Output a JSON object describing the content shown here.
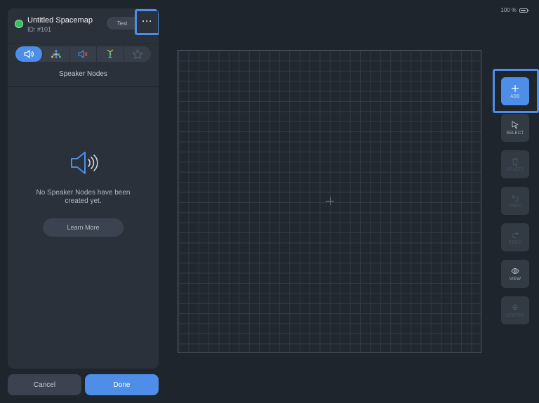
{
  "status_bar": {
    "battery": "100 %"
  },
  "panel": {
    "title": "Untitled Spacemap",
    "subtitle": "ID: #101",
    "test_label": "Test",
    "more_label": "···",
    "tabs": [
      {
        "icon": "speaker-icon",
        "active": true
      },
      {
        "icon": "node-network-icon",
        "active": false
      },
      {
        "icon": "speaker-muted-icon",
        "active": false
      },
      {
        "icon": "antenna-icon",
        "active": false
      },
      {
        "icon": "star-icon",
        "active": false
      }
    ],
    "section_title": "Speaker Nodes",
    "empty_message": "No Speaker Nodes have been created yet.",
    "learn_more_label": "Learn More",
    "cancel_label": "Cancel",
    "done_label": "Done"
  },
  "toolbar": {
    "add_label": "ADD",
    "select_label": "SELECT",
    "delete_label": "DELETE",
    "undo_label": "UNDO",
    "redo_label": "REDO",
    "view_label": "VIEW",
    "center_label": "CENTER"
  },
  "colors": {
    "accent": "#4e8ee8",
    "status_green": "#32c25a",
    "background": "#1f252d",
    "panel": "#2a313b"
  }
}
